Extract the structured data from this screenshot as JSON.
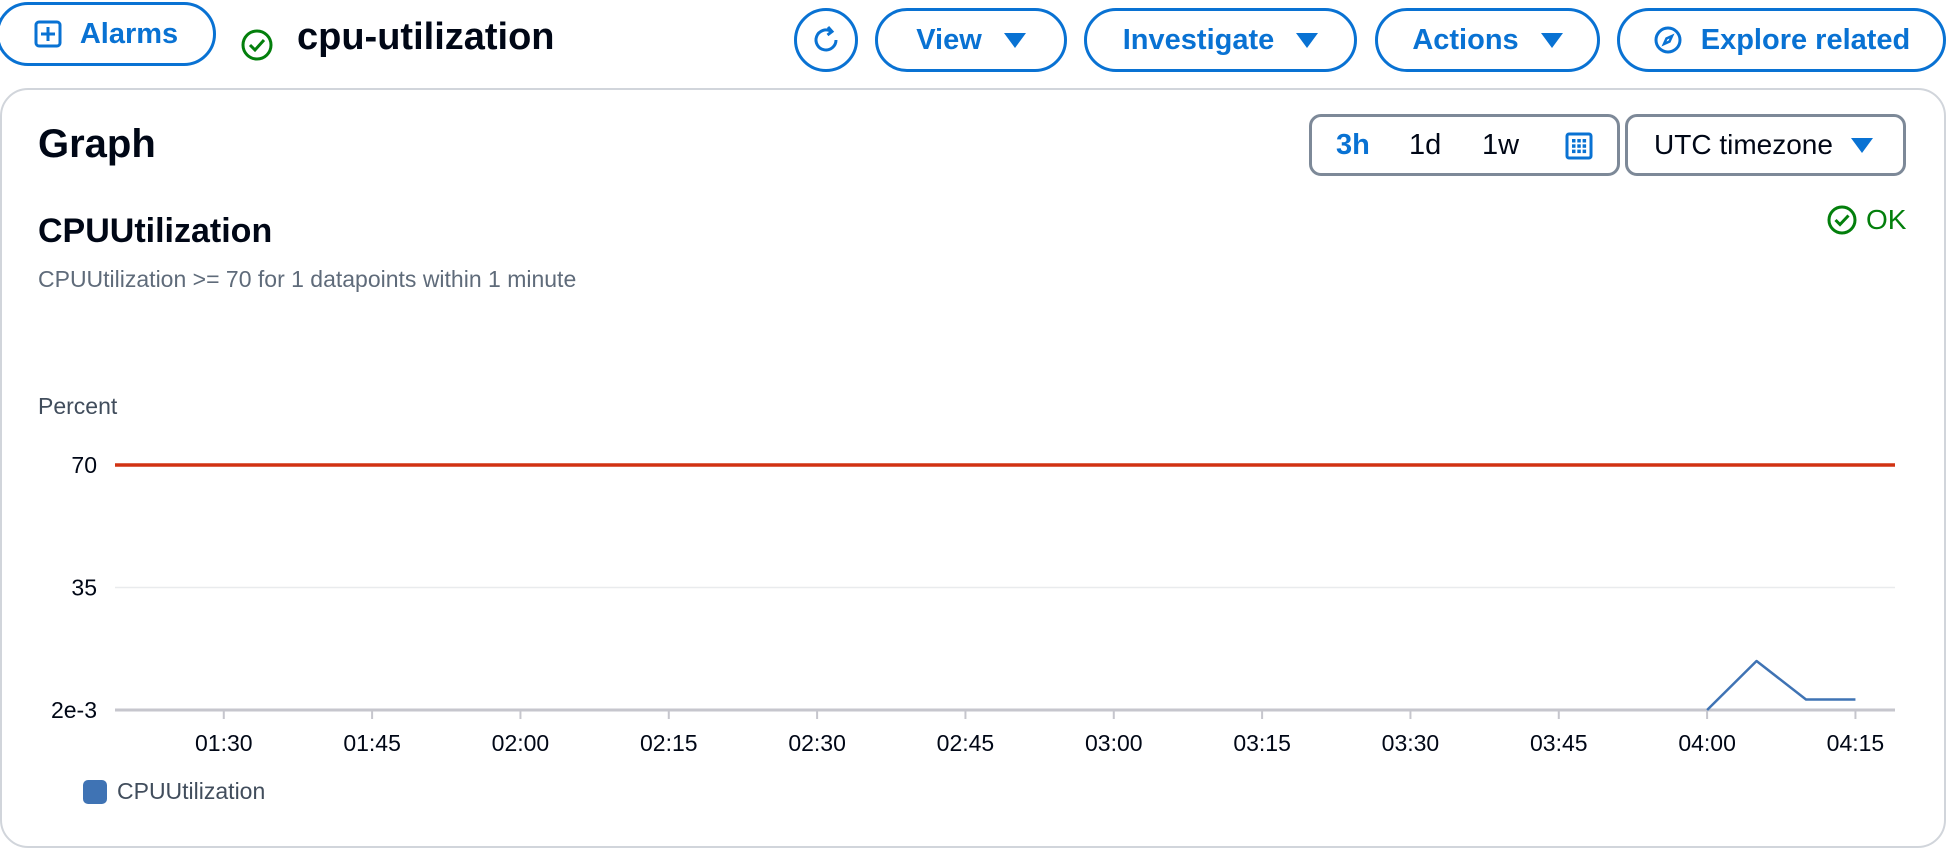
{
  "header": {
    "alarms_label": "Alarms",
    "alarm_name": "cpu-utilization",
    "view_label": "View",
    "investigate_label": "Investigate",
    "actions_label": "Actions",
    "explore_label": "Explore related"
  },
  "graph_panel": {
    "title": "Graph",
    "ranges": [
      "3h",
      "1d",
      "1w"
    ],
    "active_range": "3h",
    "timezone": "UTC timezone"
  },
  "chart_header": {
    "title": "CPUUtilization",
    "description": "CPUUtilization >= 70 for 1 datapoints within 1 minute",
    "status": "OK"
  },
  "colors": {
    "accent": "#0972d3",
    "ok": "#037f0c",
    "threshold": "#d13212",
    "series": "#3f73b4"
  },
  "chart_data": {
    "type": "line",
    "ylabel": "Percent",
    "y_ticks": [
      0.002,
      35,
      70
    ],
    "y_tick_labels": [
      "2e-3",
      "35",
      "70"
    ],
    "ylim": [
      0.002,
      70
    ],
    "x_ticks": [
      "01:30",
      "01:45",
      "02:00",
      "02:15",
      "02:30",
      "02:45",
      "03:00",
      "03:15",
      "03:30",
      "03:45",
      "04:00",
      "04:15"
    ],
    "x_range": [
      "01:19",
      "04:19"
    ],
    "threshold": 70,
    "series": [
      {
        "name": "CPUUtilization",
        "x": [
          "04:00",
          "04:05",
          "04:10",
          "04:15"
        ],
        "values": [
          0.002,
          14,
          3,
          3
        ]
      }
    ],
    "legend": [
      "CPUUtilization"
    ]
  }
}
